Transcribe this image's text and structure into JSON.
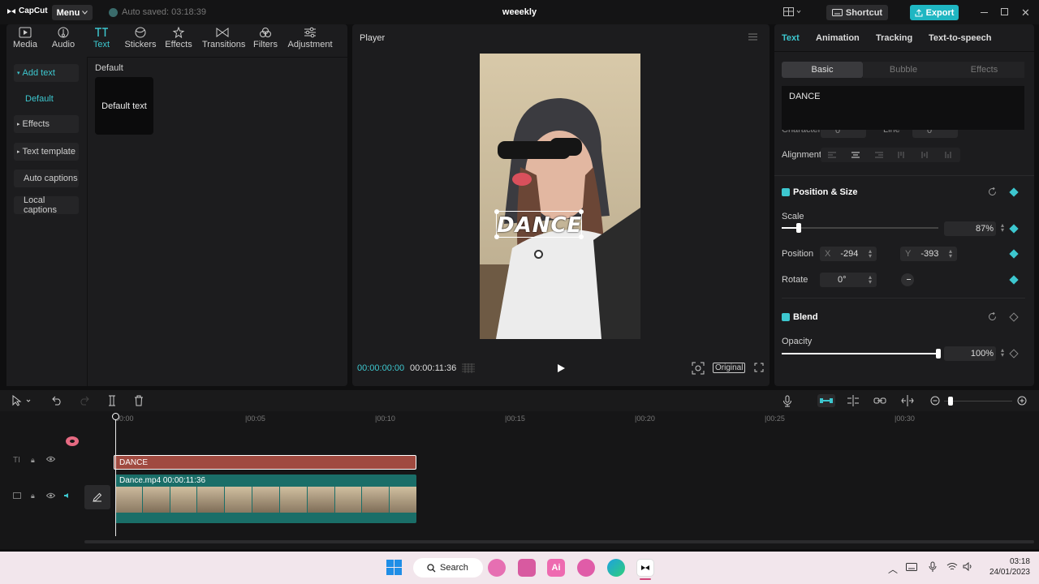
{
  "app": {
    "logo_text": "CapCut",
    "menu_label": "Menu",
    "autosave_text": "Auto saved: 03:18:39",
    "project_name": "weeekly",
    "shortcut_label": "Shortcut",
    "export_label": "Export"
  },
  "toolbar": {
    "tools": [
      "Media",
      "Audio",
      "Text",
      "Stickers",
      "Effects",
      "Transitions",
      "Filters",
      "Adjustment"
    ],
    "active": "Text"
  },
  "text_sidebar": {
    "items": [
      "Add text",
      "Default",
      "Effects",
      "Text template",
      "Auto captions",
      "Local captions"
    ]
  },
  "text_library": {
    "section_title": "Default",
    "card_label": "Default text"
  },
  "player": {
    "title": "Player",
    "overlay_text": "DANCE",
    "current_time": "00:00:00:00",
    "total_time": "00:00:11:36",
    "ratio_label": "Original"
  },
  "inspector": {
    "tabs": [
      "Text",
      "Animation",
      "Tracking",
      "Text-to-speech"
    ],
    "subtabs": [
      "Basic",
      "Bubble",
      "Effects"
    ],
    "text_value": "DANCE",
    "hidden_labels": {
      "character": "Character",
      "line": "Line",
      "value": "0"
    },
    "alignment_label": "Alignment",
    "position_size": {
      "title": "Position & Size",
      "scale_label": "Scale",
      "scale_value": "87%",
      "scale_fraction": 0.11,
      "position_label": "Position",
      "x_label": "X",
      "x_value": "-294",
      "y_label": "Y",
      "y_value": "-393",
      "rotate_label": "Rotate",
      "rotate_value": "0°"
    },
    "blend": {
      "title": "Blend",
      "opacity_label": "Opacity",
      "opacity_value": "100%",
      "opacity_fraction": 1.0
    }
  },
  "timeline": {
    "ticks": [
      "00:00",
      "00:05",
      "00:10",
      "00:15",
      "00:20",
      "00:25",
      "00:30"
    ],
    "text_clip_label": "DANCE",
    "video_clip_label": "Dance.mp4  00:00:11:36"
  },
  "taskbar": {
    "search_label": "Search",
    "time": "03:18",
    "date": "24/01/2023"
  },
  "colors": {
    "accent": "#3dc7cf",
    "text_clip": "#a04a40",
    "video_clip": "#1a6e68"
  }
}
